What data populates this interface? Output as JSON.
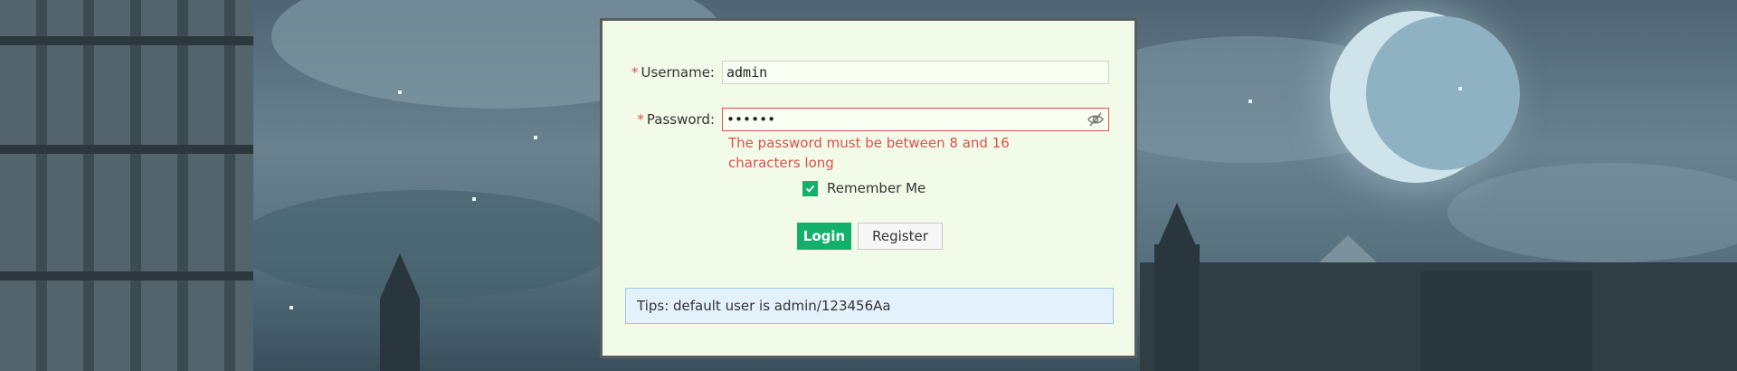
{
  "form": {
    "username": {
      "label": "Username:",
      "required_mark": "*",
      "value": "admin"
    },
    "password": {
      "label": "Password:",
      "required_mark": "*",
      "value": "••••••",
      "toggle_icon": "eye-slash-icon",
      "error": "The password must be between 8 and 16 characters long"
    },
    "remember": {
      "label": "Remember Me",
      "checked": true
    },
    "buttons": {
      "login": "Login",
      "register": "Register"
    },
    "tips": "Tips: default user is admin/123456Aa"
  },
  "colors": {
    "primary": "#13b06c",
    "error": "#e04f4f",
    "panel_bg": "#f1fbe8",
    "tips_bg": "#e3f1fb"
  }
}
